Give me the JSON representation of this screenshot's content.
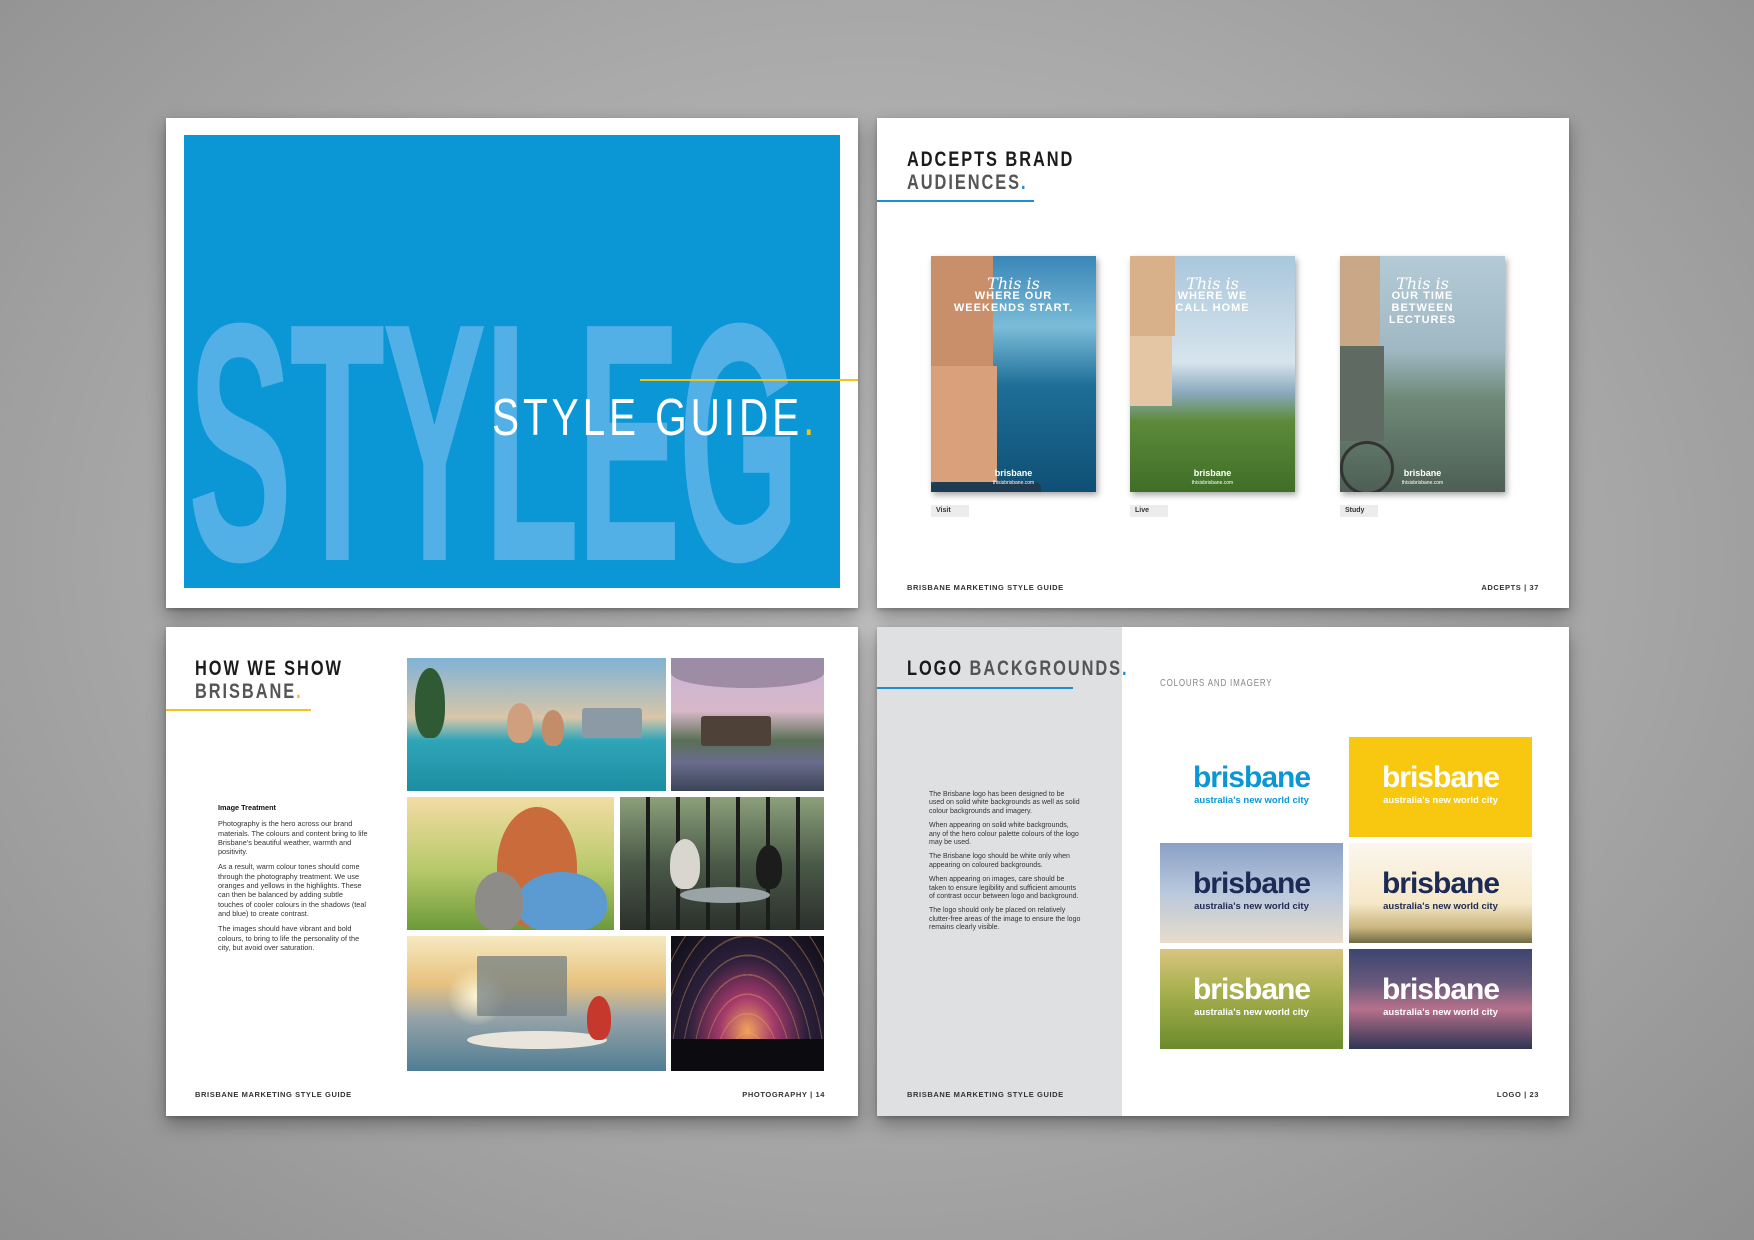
{
  "cover": {
    "big_word": "STYLEG",
    "title": "STYLE GUIDE",
    "title_dot": "."
  },
  "adcepts": {
    "heading_line1": "ADCEPTS BRAND",
    "heading_line2": "AUDIENCES",
    "heading_dot": ".",
    "posters": [
      {
        "script": "This is",
        "tag": "WHERE OUR\nWEEKENDS START.",
        "label": "Visit"
      },
      {
        "script": "This is",
        "tag": "WHERE WE\nCALL HOME",
        "label": "Live"
      },
      {
        "script": "This is",
        "tag": "OUR TIME\nBETWEEN\nLECTURES",
        "label": "Study"
      }
    ],
    "poster_brand": "brisbane",
    "poster_url": "thisisbrisbane.com",
    "footer_left": "BRISBANE MARKETING STYLE GUIDE",
    "footer_right": "ADCEPTS  |  37"
  },
  "photography": {
    "heading_line1": "HOW WE SHOW",
    "heading_line2": "BRISBANE",
    "heading_dot": ".",
    "section_title": "Image Treatment",
    "paragraphs": [
      "Photography is the hero across our brand materials. The colours and content bring to life Brisbane's beautiful weather, warmth and positivity.",
      "As a result, warm colour tones should come through the photography treatment. We use oranges and yellows in the highlights. These can then be balanced by adding subtle touches of cooler colours in the shadows (teal and blue) to create contrast.",
      "The images should have vibrant and bold colours, to bring to life the personality of the city, but avoid over saturation."
    ],
    "footer_left": "BRISBANE MARKETING STYLE GUIDE",
    "footer_right": "PHOTOGRAPHY  |  14"
  },
  "logo": {
    "heading_line1": "LOGO",
    "heading_line2": "BACKGROUNDS",
    "heading_dot": ".",
    "subheading": "COLOURS AND IMAGERY",
    "paragraphs": [
      "The Brisbane logo has been designed to be used on solid white backgrounds as well as solid colour backgrounds and imagery.",
      "When appearing on solid white backgrounds, any of the hero colour palette colours of the logo may be used.",
      "The Brisbane logo should be white only when appearing on coloured backgrounds.",
      "When appearing on images, care should be taken to ensure legibility and sufficient amounts of contrast occur between logo and background.",
      "The logo should only be placed on relatively clutter-free areas of the image to ensure the logo remains clearly visible."
    ],
    "wordmark": "brisbane",
    "tagline": "australia's new world city",
    "footer_left": "BRISBANE MARKETING STYLE GUIDE",
    "footer_right": "LOGO  |  23"
  },
  "colors": {
    "brand_blue": "#0b97d6",
    "accent_yellow": "#f0c419",
    "navy": "#1d2a55"
  }
}
